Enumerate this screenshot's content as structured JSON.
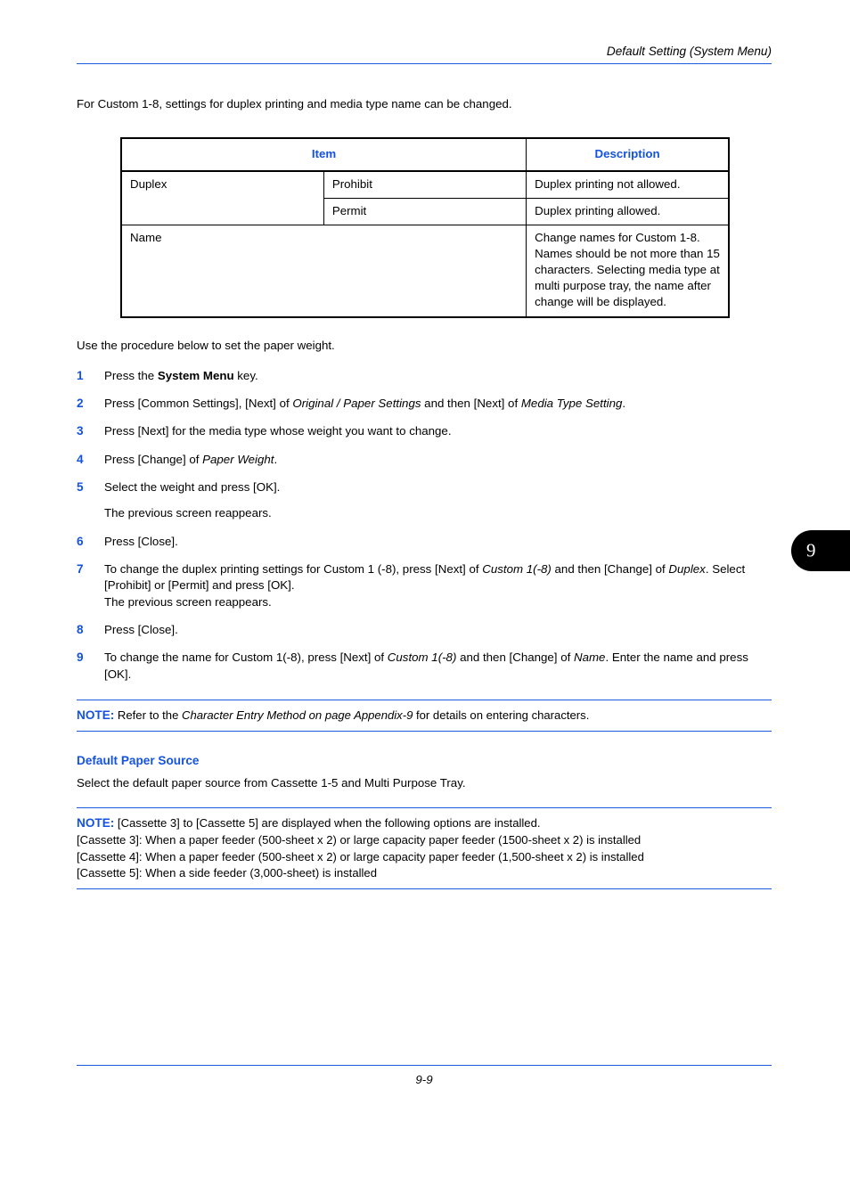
{
  "header": {
    "title": "Default Setting (System Menu)"
  },
  "intro": {
    "text": "For Custom 1-8, settings for duplex printing and media type name can be changed."
  },
  "table": {
    "headers": [
      "Item",
      "Description"
    ],
    "rows": [
      {
        "item_group": "Duplex",
        "item_sub": "Prohibit",
        "description": "Duplex printing not allowed."
      },
      {
        "item_group": "",
        "item_sub": "Permit",
        "description": "Duplex printing allowed."
      },
      {
        "item_group": "Name",
        "item_sub": "",
        "description": "Change names for Custom 1-8. Names should be not more than 15 characters. Selecting media type at multi purpose tray, the name after change will be displayed."
      }
    ]
  },
  "procedure": {
    "intro": "Use the procedure below to set the paper weight.",
    "steps": [
      {
        "num": "1",
        "parts": [
          {
            "t": "Press the ",
            "s": "n"
          },
          {
            "t": "System Menu",
            "s": "b"
          },
          {
            "t": " key.",
            "s": "n"
          }
        ]
      },
      {
        "num": "2",
        "parts": [
          {
            "t": "Press [Common Settings], [Next] of ",
            "s": "n"
          },
          {
            "t": "Original / Paper Settings",
            "s": "i"
          },
          {
            "t": " and then [Next] of ",
            "s": "n"
          },
          {
            "t": "Media Type Setting",
            "s": "i"
          },
          {
            "t": ".",
            "s": "n"
          }
        ]
      },
      {
        "num": "3",
        "parts": [
          {
            "t": "Press [Next] for the media type whose weight you want to change.",
            "s": "n"
          }
        ]
      },
      {
        "num": "4",
        "parts": [
          {
            "t": "Press [Change] of ",
            "s": "n"
          },
          {
            "t": "Paper Weight",
            "s": "i"
          },
          {
            "t": ".",
            "s": "n"
          }
        ]
      },
      {
        "num": "5",
        "parts": [
          {
            "t": "Select the weight and press [OK].",
            "s": "n"
          }
        ],
        "sub": "The previous screen reappears."
      },
      {
        "num": "6",
        "parts": [
          {
            "t": "Press [Close].",
            "s": "n"
          }
        ]
      },
      {
        "num": "7",
        "parts": [
          {
            "t": "To change the duplex printing settings for Custom 1 (-8), press [Next] of ",
            "s": "n"
          },
          {
            "t": "Custom 1(-8)",
            "s": "i"
          },
          {
            "t": " and then [Change] of ",
            "s": "n"
          },
          {
            "t": "Duplex",
            "s": "i"
          },
          {
            "t": ". Select [Prohibit] or [Permit] and press [OK].",
            "s": "n"
          },
          {
            "t": "BR",
            "s": "br"
          },
          {
            "t": "The previous screen reappears.",
            "s": "n"
          }
        ]
      },
      {
        "num": "8",
        "parts": [
          {
            "t": "Press [Close].",
            "s": "n"
          }
        ]
      },
      {
        "num": "9",
        "parts": [
          {
            "t": "To change the name for Custom 1(-8), press [Next] of ",
            "s": "n"
          },
          {
            "t": "Custom 1(-8)",
            "s": "i"
          },
          {
            "t": " and then [Change] of ",
            "s": "n"
          },
          {
            "t": "Name",
            "s": "i"
          },
          {
            "t": ". Enter the name and press [OK].",
            "s": "n"
          }
        ]
      }
    ]
  },
  "note1": {
    "label": "NOTE:",
    "parts": [
      {
        "t": " Refer to the ",
        "s": "n"
      },
      {
        "t": "Character Entry Method on page Appendix-9",
        "s": "i"
      },
      {
        "t": " for details on entering characters.",
        "s": "n"
      }
    ]
  },
  "section": {
    "heading": "Default Paper Source",
    "body": "Select the default paper source from Cassette 1-5 and Multi Purpose Tray."
  },
  "note2": {
    "label": "NOTE:",
    "lead": "  [Cassette 3] to [Cassette 5] are displayed when the following options are installed.",
    "lines": [
      "[Cassette 3]: When a paper feeder (500-sheet x 2) or large capacity paper feeder (1500-sheet x 2) is installed",
      "[Cassette 4]: When a paper feeder (500-sheet x 2) or large capacity paper feeder (1,500-sheet x 2) is installed",
      "[Cassette 5]: When a side feeder (3,000-sheet) is installed"
    ]
  },
  "side_tab": {
    "label": "9"
  },
  "footer": {
    "page_number": "9-9"
  },
  "colors": {
    "accent_blue": "#1452e0",
    "rule_blue": "#1a5ce0",
    "text": "#000000",
    "tab_bg": "#000000"
  }
}
